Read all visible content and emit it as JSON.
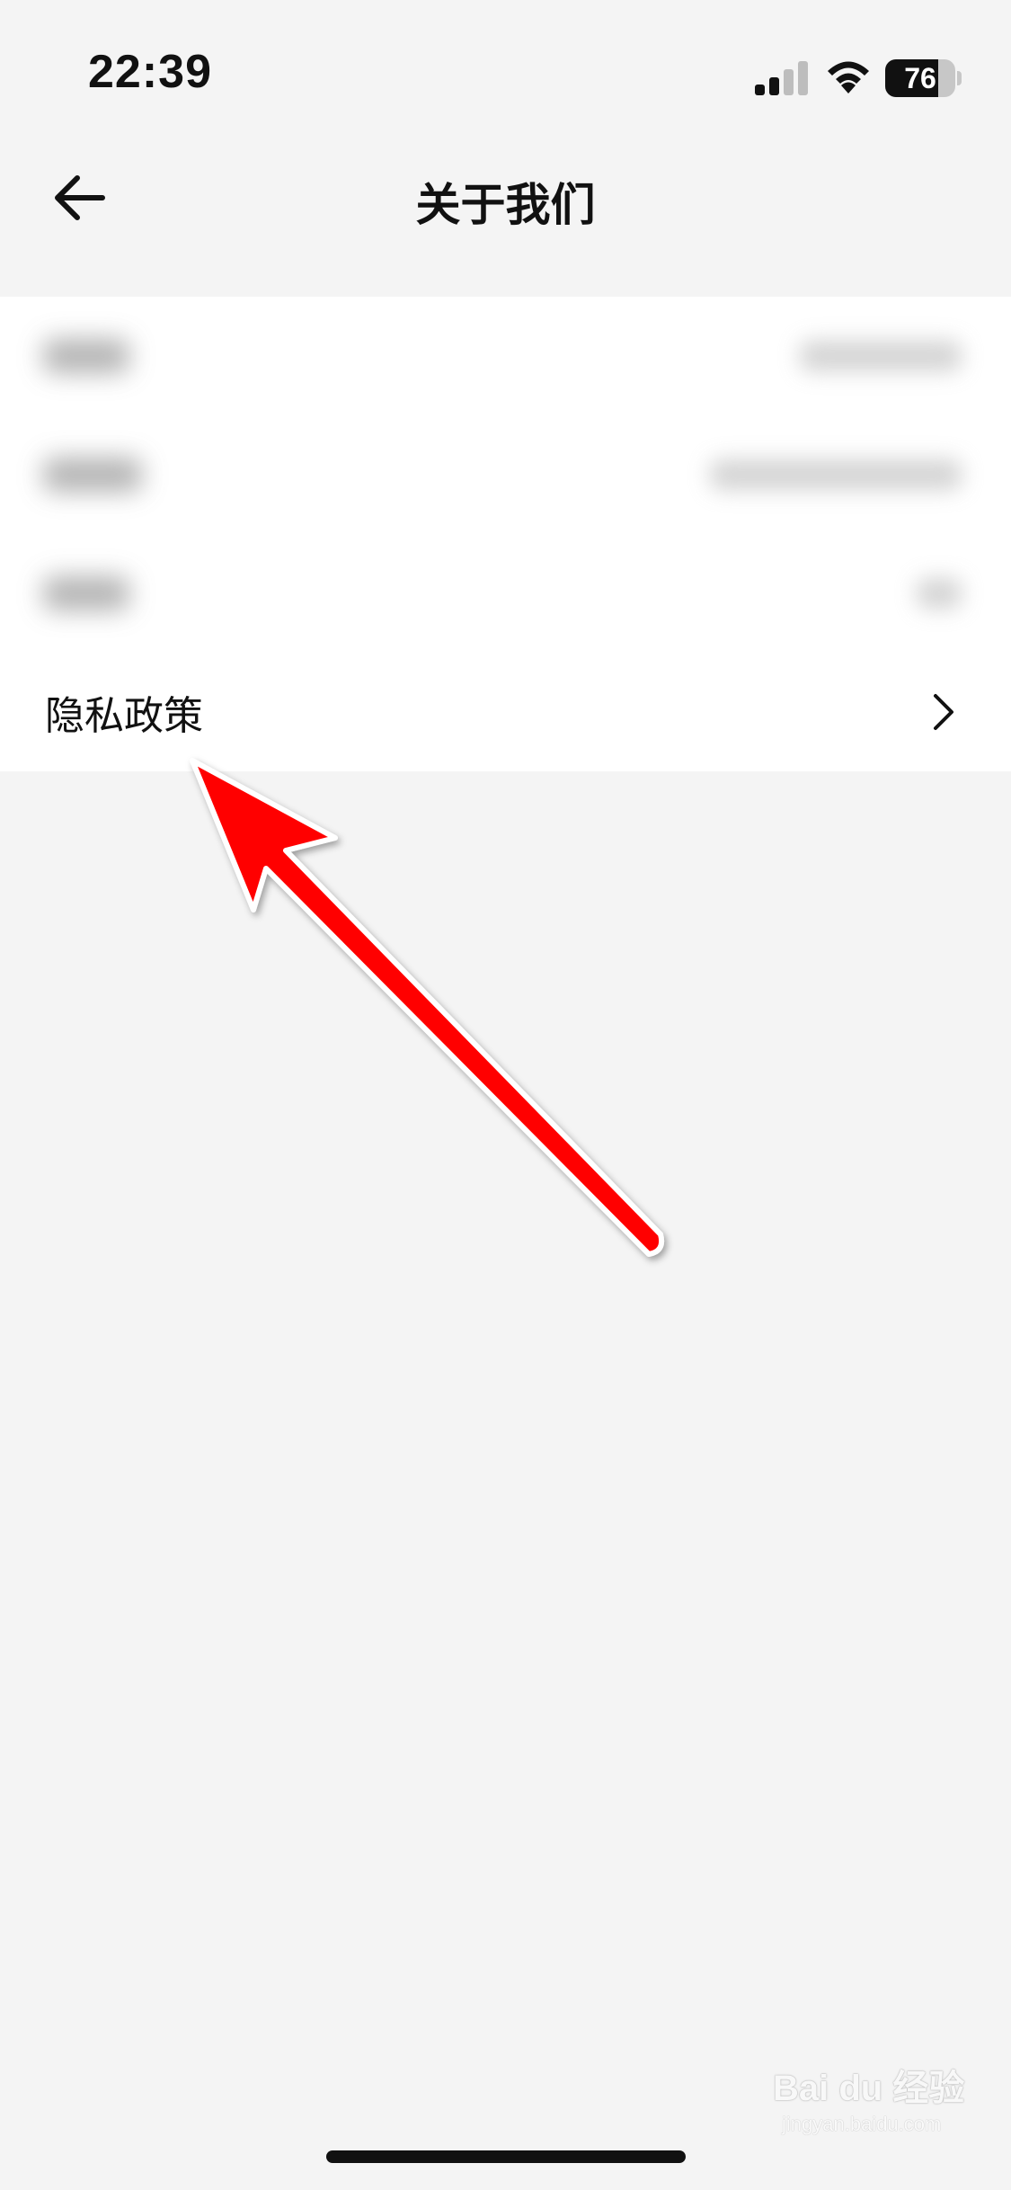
{
  "status_bar": {
    "time": "22:39",
    "battery_level": "76",
    "icons": [
      "signal-icon",
      "wifi-icon",
      "battery-icon"
    ]
  },
  "nav": {
    "title": "关于我们",
    "back_icon": "arrow-left-icon"
  },
  "info_rows": [
    {
      "label": "",
      "value": "",
      "blurred": true
    },
    {
      "label": "",
      "value": "",
      "blurred": true
    },
    {
      "label": "",
      "value": "",
      "blurred": true
    },
    {
      "label": "隐私政策",
      "chevron": "chevron-right-icon",
      "blurred": false
    }
  ],
  "watermark": {
    "brand": "Bai du 经验",
    "url": "jingyan.baidu.com"
  },
  "colors": {
    "page_background": "#f4f4f4",
    "card_background": "#ffffff",
    "annotation_arrow": "#ff0000",
    "text_primary": "#111111"
  }
}
